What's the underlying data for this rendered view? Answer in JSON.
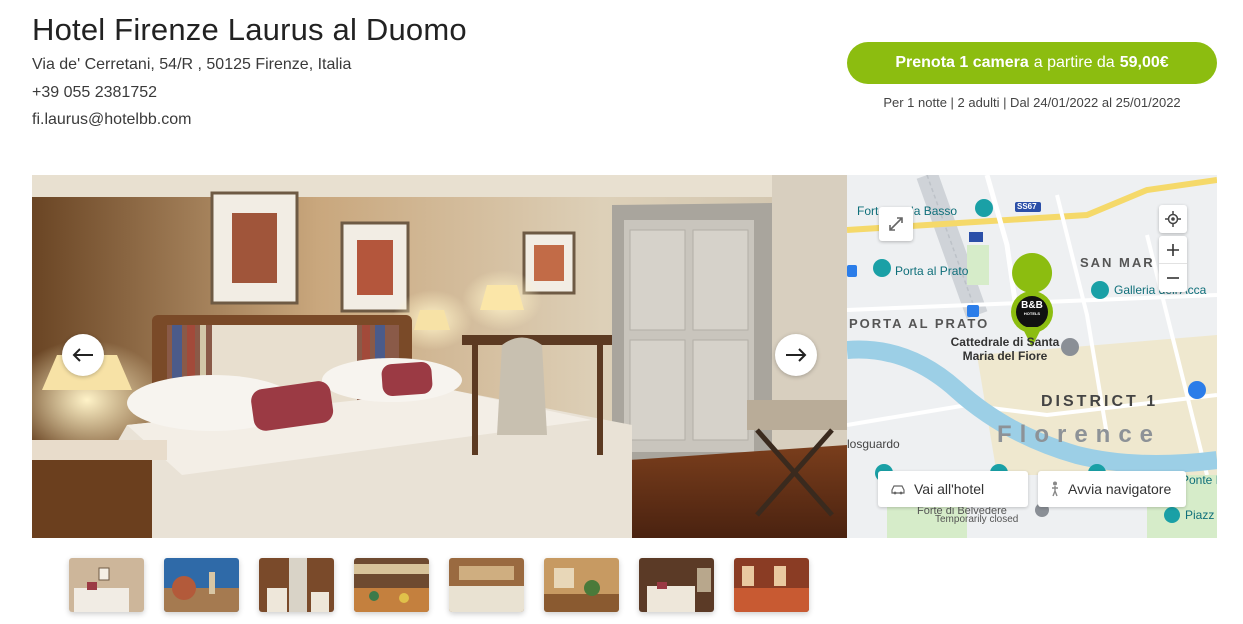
{
  "hotel": {
    "name": "Hotel Firenze Laurus al Duomo",
    "address": "Via de' Cerretani, 54/R , 50125 Firenze, Italia",
    "phone": "+39 055 2381752",
    "email": "fi.laurus@hotelbb.com"
  },
  "booking": {
    "button_strong": "Prenota 1 camera",
    "button_mid": "a partire da",
    "button_price": "59,00€",
    "details": "Per 1 notte | 2 adulti | Dal 24/01/2022 al 25/01/2022",
    "accent_color": "#8cbd10"
  },
  "gallery": {
    "prev_icon": "arrow-left-icon",
    "next_icon": "arrow-right-icon",
    "thumbnail_count": 8
  },
  "map": {
    "labels": {
      "fortezza": "Fortezza da Basso",
      "ss67": "SS67",
      "porta_prato": "Porta al Prato",
      "porta_prato_area": "PORTA AL PRATO",
      "san_marco": "SAN MAR",
      "galleria": "Galleria dell'Acca",
      "cathedral": "Cattedrale di Santa Maria del Fiore",
      "district": "DISTRICT 1",
      "city": "Florence",
      "bellosguardo": "losguardo",
      "forte": "Forte di Belvedere",
      "forte_status": "Temporarily closed",
      "piazza": "Piazz",
      "ponte": "Ponte B"
    },
    "pin_label": "B&B",
    "pin_sub": "HOTELS",
    "go_hotel": "Vai all'hotel",
    "navigator": "Avvia navigatore"
  }
}
